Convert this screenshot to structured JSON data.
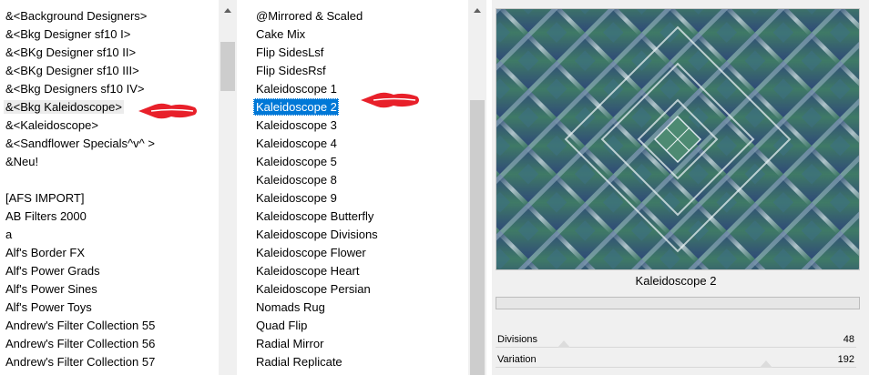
{
  "categories": {
    "items": [
      "&<Background Designers>",
      "&<Bkg Designer sf10 I>",
      "&<BKg Designer sf10 II>",
      "&<BKg Designer sf10 III>",
      "&<Bkg Designers sf10 IV>",
      "&<Bkg Kaleidoscope>",
      "&<Kaleidoscope>",
      "&<Sandflower Specials^v^ >",
      "&Neu!",
      "",
      "[AFS IMPORT]",
      "AB Filters 2000",
      "a",
      "Alf's Border FX",
      "Alf's Power Grads",
      "Alf's Power Sines",
      "Alf's Power Toys",
      "Andrew's Filter Collection 55",
      "Andrew's Filter Collection 56",
      "Andrew's Filter Collection 57"
    ],
    "hovered": "&<Bkg Kaleidoscope>"
  },
  "filters": {
    "items": [
      "@Mirrored & Scaled",
      "Cake Mix",
      "Flip SidesLsf",
      "Flip SidesRsf",
      "Kaleidoscope 1",
      "Kaleidoscope 2",
      "Kaleidoscope 3",
      "Kaleidoscope 4",
      "Kaleidoscope 5",
      "Kaleidoscope 8",
      "Kaleidoscope 9",
      "Kaleidoscope Butterfly",
      "Kaleidoscope Divisions",
      "Kaleidoscope Flower",
      "Kaleidoscope Heart",
      "Kaleidoscope Persian",
      "Nomads Rug",
      "Quad Flip",
      "Radial Mirror",
      "Radial Replicate"
    ],
    "selected": "Kaleidoscope 2"
  },
  "preview": {
    "caption": "Kaleidoscope 2"
  },
  "sliders": [
    {
      "label": "Divisions",
      "value": "48",
      "level": 0.19
    },
    {
      "label": "Variation",
      "value": "192",
      "level": 0.75
    }
  ],
  "colors": {
    "selection": "#0078d7",
    "arrow_marker": "#e8202a",
    "pattern_green": "#3f7a66",
    "pattern_blue": "#2f4a78",
    "pattern_light": "#dfe9ee"
  },
  "icons": [
    "arrow-marker-icon",
    "scroll-up-arrow-icon"
  ]
}
